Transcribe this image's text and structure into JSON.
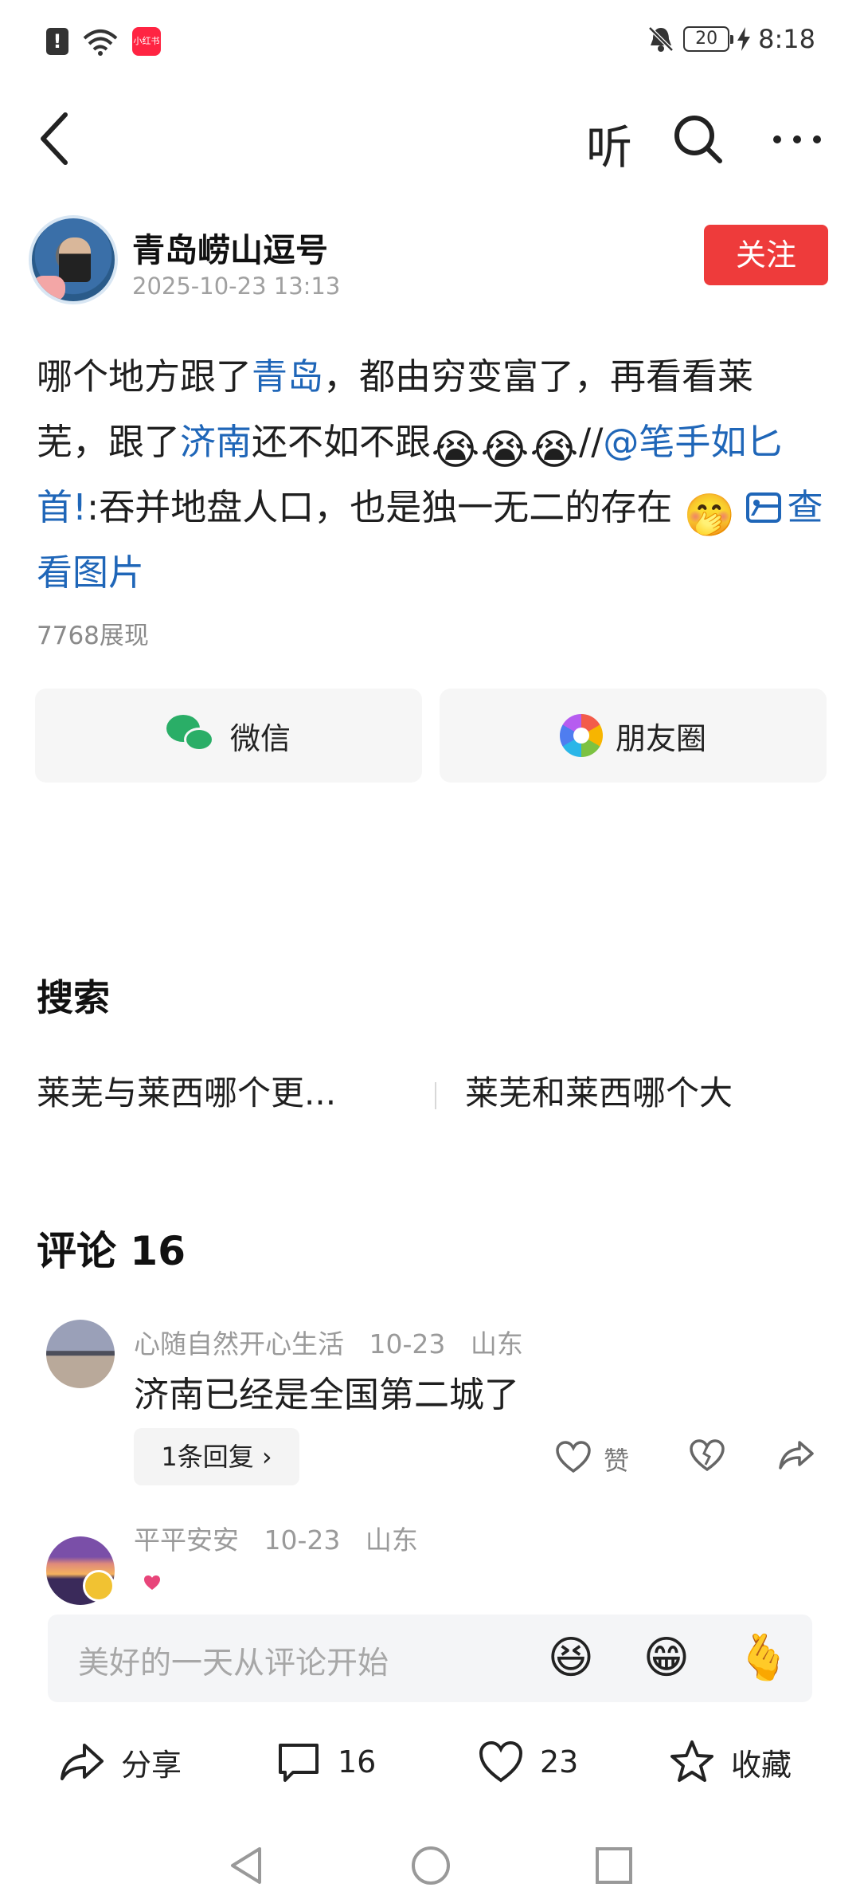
{
  "status_bar": {
    "time": "8:18",
    "battery": "20",
    "app_badge": "小红书"
  },
  "nav": {
    "listen_label": "听"
  },
  "author": {
    "name": "青岛崂山逗号",
    "time": "2025-10-23 13:13",
    "follow_label": "关注"
  },
  "post": {
    "seg1": "哪个地方跟了",
    "link1": "青岛",
    "seg2": "，都由穷变富了，再看看莱芜，跟了",
    "link2": "济南",
    "seg3": "还不如不跟",
    "seg4": "//",
    "mention": "@笔手如匕首!",
    "seg5": ":吞并地盘人口，也是独一无二的存在",
    "view_image_label": "查看图片",
    "emoji_laugh": "😭",
    "emoji_shy": "🤭"
  },
  "views": "7768展现",
  "share": {
    "wechat_label": "微信",
    "moments_label": "朋友圈"
  },
  "search": {
    "title": "搜索",
    "suggestions": [
      "莱芜与莱西哪个更...",
      "莱芜和莱西哪个大"
    ]
  },
  "comments": {
    "title": "评论 16",
    "items": [
      {
        "user": "心随自然开心生活",
        "date": "10-23",
        "region": "山东",
        "text": "济南已经是全国第二城了",
        "reply_label": "1条回复 ›",
        "like_label": "赞"
      },
      {
        "user": "平平安安",
        "date": "10-23",
        "region": "山东"
      }
    ]
  },
  "comment_input": {
    "placeholder": "美好的一天从评论开始",
    "emojis": [
      "😆",
      "😁",
      "🫰"
    ]
  },
  "actions": {
    "share_label": "分享",
    "comment_count": "16",
    "like_count": "23",
    "favorite_label": "收藏"
  },
  "colors": {
    "accent_red": "#ee3b3b",
    "link_blue": "#1f66b8",
    "wechat_green": "#2aae67"
  }
}
